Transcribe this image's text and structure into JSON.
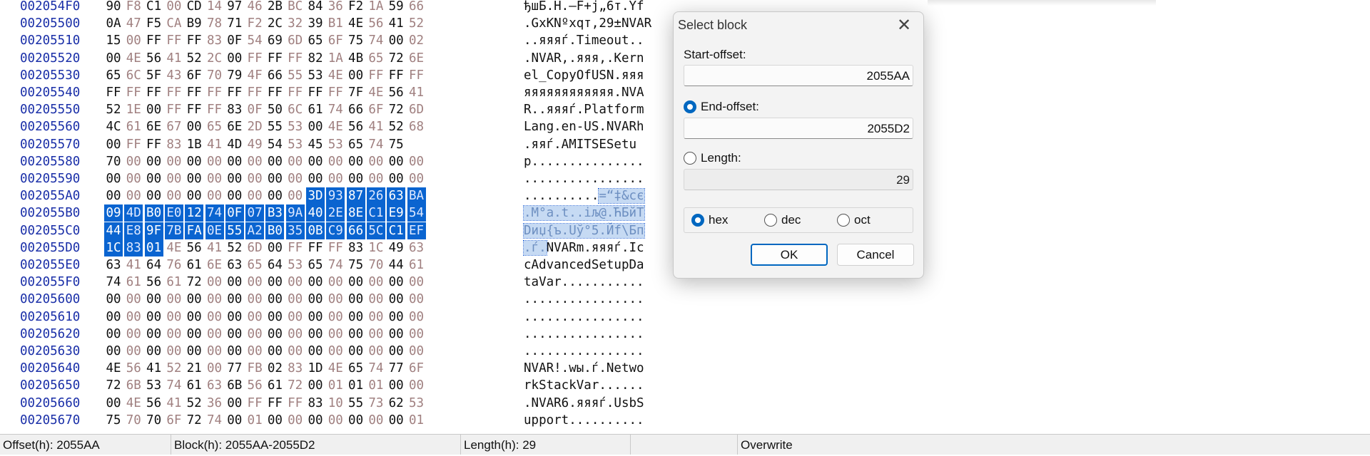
{
  "hex_rows": [
    {
      "offset": "002054F0",
      "bytes": [
        "90",
        "F8",
        "C1",
        "00",
        "CD",
        "14",
        "97",
        "46",
        "2B",
        "BC",
        "84",
        "36",
        "F2",
        "1A",
        "59",
        "66"
      ],
      "ascii": "ђшБ.Н.—F+j„6т.Yf"
    },
    {
      "offset": "00205500",
      "bytes": [
        "0A",
        "47",
        "F5",
        "CA",
        "B9",
        "78",
        "71",
        "F2",
        "2C",
        "32",
        "39",
        "B1",
        "4E",
        "56",
        "41",
        "52"
      ],
      "ascii": ".GxКNºxqт,29±NVAR"
    },
    {
      "offset": "00205510",
      "bytes": [
        "15",
        "00",
        "FF",
        "FF",
        "FF",
        "83",
        "0F",
        "54",
        "69",
        "6D",
        "65",
        "6F",
        "75",
        "74",
        "00",
        "02"
      ],
      "ascii": "..яяяѓ.Timeout.."
    },
    {
      "offset": "00205520",
      "bytes": [
        "00",
        "4E",
        "56",
        "41",
        "52",
        "2C",
        "00",
        "FF",
        "FF",
        "FF",
        "82",
        "1A",
        "4B",
        "65",
        "72",
        "6E"
      ],
      "ascii": ".NVAR,.яяя‚.Kern"
    },
    {
      "offset": "00205530",
      "bytes": [
        "65",
        "6C",
        "5F",
        "43",
        "6F",
        "70",
        "79",
        "4F",
        "66",
        "55",
        "53",
        "4E",
        "00",
        "FF",
        "FF",
        "FF"
      ],
      "ascii": "el_CopyOfUSN.яяя"
    },
    {
      "offset": "00205540",
      "bytes": [
        "FF",
        "FF",
        "FF",
        "FF",
        "FF",
        "FF",
        "FF",
        "FF",
        "FF",
        "FF",
        "FF",
        "FF",
        "7F",
        "4E",
        "56",
        "41"
      ],
      "ascii": "яяяяяяяяяяяя.NVA"
    },
    {
      "offset": "00205550",
      "bytes": [
        "52",
        "1E",
        "00",
        "FF",
        "FF",
        "FF",
        "83",
        "0F",
        "50",
        "6C",
        "61",
        "74",
        "66",
        "6F",
        "72",
        "6D"
      ],
      "ascii": "R..яяяѓ.Platform"
    },
    {
      "offset": "00205560",
      "bytes": [
        "4C",
        "61",
        "6E",
        "67",
        "00",
        "65",
        "6E",
        "2D",
        "55",
        "53",
        "00",
        "4E",
        "56",
        "41",
        "52",
        "68"
      ],
      "ascii": "Lang.en-US.NVARh"
    },
    {
      "offset": "00205570",
      "bytes": [
        "00",
        "FF",
        "FF",
        "83",
        "1B",
        "41",
        "4D",
        "49",
        "54",
        "53",
        "45",
        "53",
        "65",
        "74",
        "75"
      ],
      "ascii": ".яяѓ.AMITSESetu"
    },
    {
      "offset": "00205580",
      "bytes": [
        "70",
        "00",
        "00",
        "00",
        "00",
        "00",
        "00",
        "00",
        "00",
        "00",
        "00",
        "00",
        "00",
        "00",
        "00",
        "00"
      ],
      "ascii": "p..............."
    },
    {
      "offset": "00205590",
      "bytes": [
        "00",
        "00",
        "00",
        "00",
        "00",
        "00",
        "00",
        "00",
        "00",
        "00",
        "00",
        "00",
        "00",
        "00",
        "00",
        "00"
      ],
      "ascii": "................"
    },
    {
      "offset": "002055A0",
      "bytes": [
        "00",
        "00",
        "00",
        "00",
        "00",
        "00",
        "00",
        "00",
        "00",
        "00",
        "3D",
        "93",
        "87",
        "26",
        "63",
        "BA"
      ],
      "ascii": "..........=“‡&cє"
    },
    {
      "offset": "002055B0",
      "bytes": [
        "09",
        "4D",
        "B0",
        "E0",
        "12",
        "74",
        "0F",
        "07",
        "B3",
        "9A",
        "40",
        "2E",
        "8E",
        "C1",
        "E9",
        "54"
      ],
      "ascii": ".M°а.t..іљ@.ЋБйТ"
    },
    {
      "offset": "002055C0",
      "bytes": [
        "44",
        "E8",
        "9F",
        "7B",
        "FA",
        "0E",
        "55",
        "A2",
        "B0",
        "35",
        "0B",
        "C9",
        "66",
        "5C",
        "C1",
        "EF"
      ],
      "ascii": "Dиџ{ъ.Uў°5.Йf\\Бп"
    },
    {
      "offset": "002055D0",
      "bytes": [
        "1C",
        "83",
        "01",
        "4E",
        "56",
        "41",
        "52",
        "6D",
        "00",
        "FF",
        "FF",
        "FF",
        "83",
        "1C",
        "49",
        "63"
      ],
      "ascii": ".ѓ.NVARm.яяяѓ.Ic"
    },
    {
      "offset": "002055E0",
      "bytes": [
        "63",
        "41",
        "64",
        "76",
        "61",
        "6E",
        "63",
        "65",
        "64",
        "53",
        "65",
        "74",
        "75",
        "70",
        "44",
        "61"
      ],
      "ascii": "cAdvancedSetupDa"
    },
    {
      "offset": "002055F0",
      "bytes": [
        "74",
        "61",
        "56",
        "61",
        "72",
        "00",
        "00",
        "00",
        "00",
        "00",
        "00",
        "00",
        "00",
        "00",
        "00",
        "00"
      ],
      "ascii": "taVar..........."
    },
    {
      "offset": "00205600",
      "bytes": [
        "00",
        "00",
        "00",
        "00",
        "00",
        "00",
        "00",
        "00",
        "00",
        "00",
        "00",
        "00",
        "00",
        "00",
        "00",
        "00"
      ],
      "ascii": "................"
    },
    {
      "offset": "00205610",
      "bytes": [
        "00",
        "00",
        "00",
        "00",
        "00",
        "00",
        "00",
        "00",
        "00",
        "00",
        "00",
        "00",
        "00",
        "00",
        "00",
        "00"
      ],
      "ascii": "................"
    },
    {
      "offset": "00205620",
      "bytes": [
        "00",
        "00",
        "00",
        "00",
        "00",
        "00",
        "00",
        "00",
        "00",
        "00",
        "00",
        "00",
        "00",
        "00",
        "00",
        "00"
      ],
      "ascii": "................"
    },
    {
      "offset": "00205630",
      "bytes": [
        "00",
        "00",
        "00",
        "00",
        "00",
        "00",
        "00",
        "00",
        "00",
        "00",
        "00",
        "00",
        "00",
        "00",
        "00",
        "00"
      ],
      "ascii": "................"
    },
    {
      "offset": "00205640",
      "bytes": [
        "4E",
        "56",
        "41",
        "52",
        "21",
        "00",
        "77",
        "FB",
        "02",
        "83",
        "1D",
        "4E",
        "65",
        "74",
        "77",
        "6F"
      ],
      "ascii": "NVAR!.wы.ѓ.Netwo"
    },
    {
      "offset": "00205650",
      "bytes": [
        "72",
        "6B",
        "53",
        "74",
        "61",
        "63",
        "6B",
        "56",
        "61",
        "72",
        "00",
        "01",
        "01",
        "01",
        "00",
        "00"
      ],
      "ascii": "rkStackVar......"
    },
    {
      "offset": "00205660",
      "bytes": [
        "00",
        "4E",
        "56",
        "41",
        "52",
        "36",
        "00",
        "FF",
        "FF",
        "FF",
        "83",
        "10",
        "55",
        "73",
        "62",
        "53"
      ],
      "ascii": ".NVAR6.яяяѓ.UsbS"
    },
    {
      "offset": "00205670",
      "bytes": [
        "75",
        "70",
        "70",
        "6F",
        "72",
        "74",
        "00",
        "01",
        "00",
        "00",
        "00",
        "00",
        "00",
        "00",
        "00",
        "01"
      ],
      "ascii": "upport.........."
    }
  ],
  "selection": {
    "start_offset": "2055AA",
    "end_offset": "2055D2",
    "length": "29"
  },
  "dialog": {
    "title": "Select block",
    "start_label": "Start-offset:",
    "start_value": "2055AA",
    "end_label": "End-offset:",
    "end_value": "2055D2",
    "length_label": "Length:",
    "length_value": "29",
    "radix_options": [
      "hex",
      "dec",
      "oct"
    ],
    "selected_radix": "hex",
    "selected_offset_mode": "End-offset",
    "ok_label": "OK",
    "cancel_label": "Cancel"
  },
  "statusbar": {
    "offset": "Offset(h): 2055AA",
    "block": "Block(h): 2055AA-2055D2",
    "length": "Length(h): 29",
    "empty": "",
    "mode": "Overwrite"
  },
  "colors": {
    "offset_text": "#1a2fa8",
    "selection": "#0a64d0",
    "ascii_selection": "#c6daf3",
    "accent": "#0067c0"
  }
}
